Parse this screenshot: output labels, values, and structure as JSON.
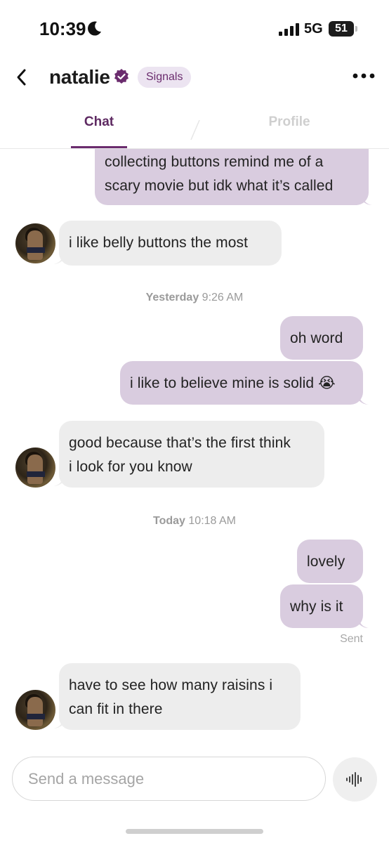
{
  "status_bar": {
    "time": "10:39",
    "network": "5G",
    "battery": "51"
  },
  "header": {
    "name": "natalie",
    "badge": "Signals"
  },
  "tabs": [
    {
      "label": "Chat",
      "active": true
    },
    {
      "label": "Profile",
      "active": false
    }
  ],
  "messages": [
    {
      "from": "me",
      "text_line1": "collecting buttons remind me of a",
      "text_line2": "scary movie but idk what it’s called"
    },
    {
      "from": "them",
      "text": "i like belly buttons the most"
    },
    {
      "type": "timestamp",
      "day": "Yesterday",
      "time": "9:26 AM"
    },
    {
      "from": "me",
      "text": "oh word"
    },
    {
      "from": "me",
      "text": "i like to believe mine is solid 😭"
    },
    {
      "from": "them",
      "text_line1": "good because that’s the first think",
      "text_line2": "i look for you know"
    },
    {
      "type": "timestamp",
      "day": "Today",
      "time": "10:18 AM"
    },
    {
      "from": "me",
      "text": "lovely"
    },
    {
      "from": "me",
      "text": "why is it",
      "status": "Sent"
    },
    {
      "from": "them",
      "text_line1": "have to see how many raisins i",
      "text_line2": "can fit in there"
    }
  ],
  "composer": {
    "placeholder": "Send a message"
  },
  "colors": {
    "accent": "#6b2c6e",
    "outgoing_bubble": "#d9ccdf",
    "incoming_bubble": "#ededed"
  },
  "icons": {
    "back": "chevron-left-icon",
    "verified": "verified-badge-icon",
    "more": "more-dots-icon",
    "voice": "waveform-icon"
  }
}
